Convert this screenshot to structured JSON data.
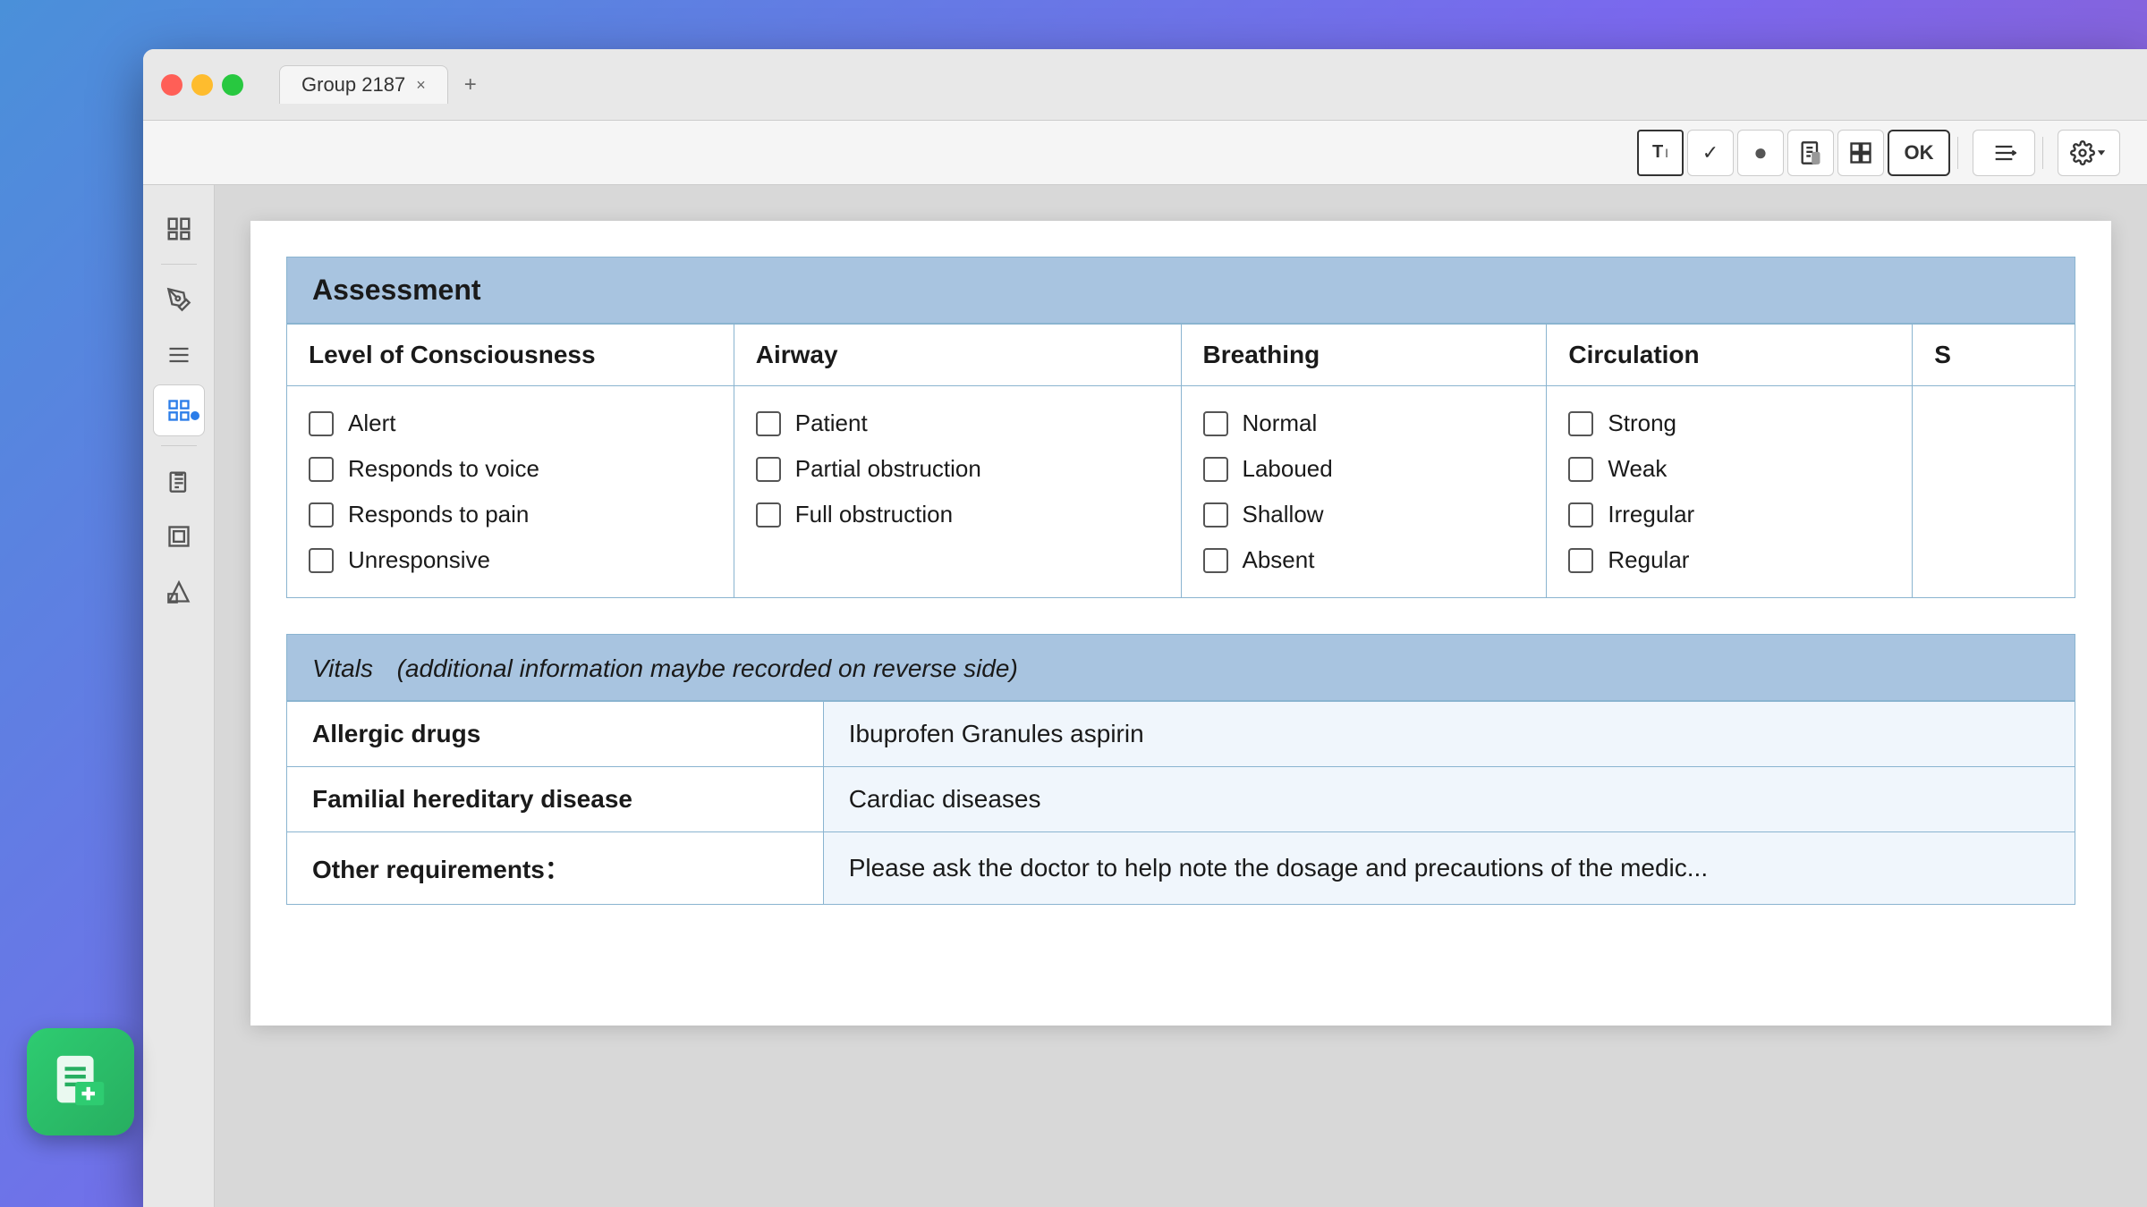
{
  "window": {
    "title": "Group 2187",
    "tab_close": "×",
    "tab_add": "+"
  },
  "traffic_lights": {
    "red": "red",
    "yellow": "yellow",
    "green": "green"
  },
  "toolbar": {
    "text_tool": "T",
    "check_tool": "✓",
    "record_tool": "⏺",
    "doc_tool": "📄",
    "layout_tool": "⊞",
    "ok_tool": "OK",
    "separator": "|",
    "list_tool": "≡",
    "settings_tool": "⚙"
  },
  "sidebar": {
    "items": [
      {
        "icon": "≡",
        "label": "pages",
        "active": false
      },
      {
        "icon": "✏",
        "label": "markup",
        "active": false
      },
      {
        "icon": "☰",
        "label": "list",
        "active": false
      },
      {
        "icon": "⊞",
        "label": "grid",
        "active": true
      },
      {
        "icon": "—",
        "label": "divider1",
        "type": "divider"
      },
      {
        "icon": "📋",
        "label": "clipboard",
        "active": false
      },
      {
        "icon": "⊡",
        "label": "frame",
        "active": false
      },
      {
        "icon": "◈",
        "label": "shape",
        "active": false
      }
    ]
  },
  "assessment": {
    "section_title": "Assessment",
    "columns": {
      "loc": "Level of Consciousness",
      "airway": "Airway",
      "breathing": "Breathing",
      "circulation": "Circulation",
      "s": "S"
    },
    "loc_items": [
      "Alert",
      "Responds to voice",
      "Responds to pain",
      "Unresponsive"
    ],
    "airway_items": [
      "Patient",
      "Partial obstruction",
      "Full obstruction"
    ],
    "breathing_items": [
      "Normal",
      "Laboued",
      "Shallow",
      "Absent"
    ],
    "circulation_items": [
      "Strong",
      "Weak",
      "Irregular",
      "Regular"
    ]
  },
  "vitals": {
    "section_title": "Vitals",
    "subtitle": "(additional information maybe recorded on reverse side)",
    "rows": [
      {
        "label": "Allergic drugs",
        "value": "Ibuprofen Granules  aspirin"
      },
      {
        "label": "Familial hereditary disease",
        "value": "Cardiac diseases"
      },
      {
        "label": "Other requirements：",
        "value": "Please ask the doctor to help note the dosage and precautions of the medic..."
      }
    ]
  },
  "app_icon": "📋"
}
